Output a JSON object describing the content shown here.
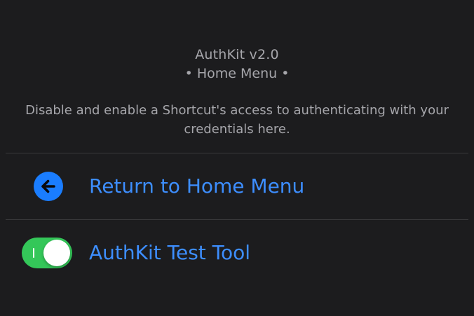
{
  "header": {
    "app_title": "AuthKit v2.0",
    "subtitle": "• Home Menu •"
  },
  "description": "Disable and enable a Shortcut's access to authenticating with your credentials here.",
  "menu": {
    "items": [
      {
        "label": "Return to Home Menu",
        "icon": "back-arrow-icon"
      },
      {
        "label": "AuthKit Test Tool",
        "toggle_state": "on"
      }
    ]
  },
  "colors": {
    "background": "#1c1c1e",
    "secondary_text": "#a6a6ab",
    "accent": "#3d8eff",
    "toggle_on": "#34c759",
    "divider": "#3a3a3c"
  }
}
